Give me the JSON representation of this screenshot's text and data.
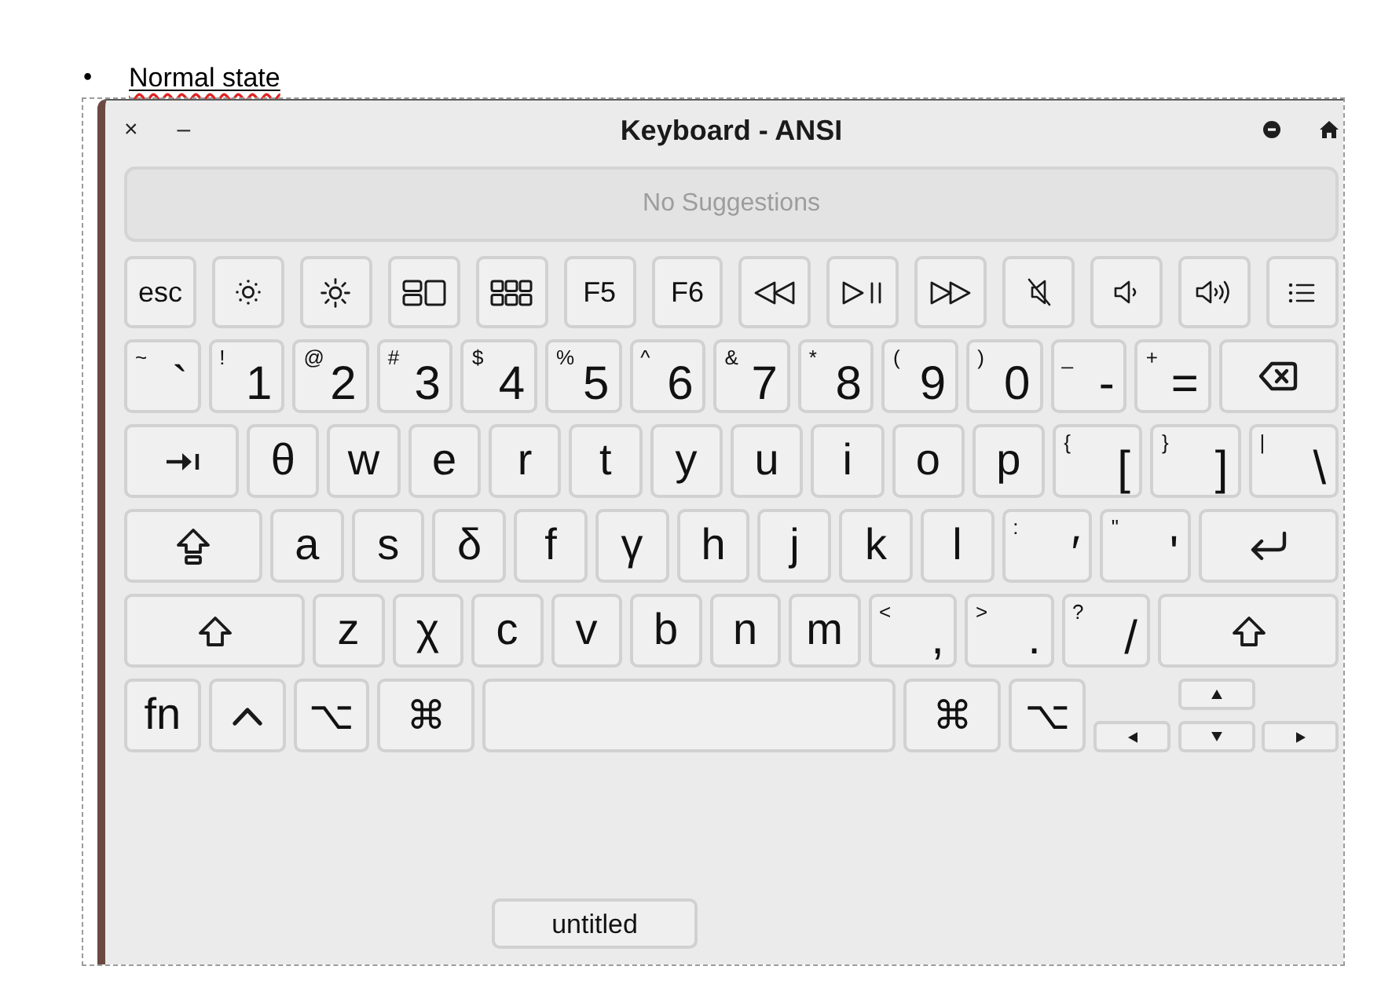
{
  "list_item": {
    "marker": "•",
    "text": "Normal state",
    "underlined": true,
    "spelling_flagged": true
  },
  "window": {
    "close": "×",
    "minimize": "–",
    "title": "Keyboard - ANSI"
  },
  "suggestions": {
    "text": "No Suggestions"
  },
  "keyboard": {
    "rows": [
      {
        "keys": [
          {
            "kind": "text",
            "label": "esc"
          },
          {
            "kind": "dimmer"
          },
          {
            "kind": "brighter"
          },
          {
            "kind": "spaces"
          },
          {
            "kind": "launchpad"
          },
          {
            "kind": "text",
            "label": "F5"
          },
          {
            "kind": "text",
            "label": "F6"
          },
          {
            "kind": "rewind"
          },
          {
            "kind": "play"
          },
          {
            "kind": "forward"
          },
          {
            "kind": "mute"
          },
          {
            "kind": "quieter"
          },
          {
            "kind": "louder"
          },
          {
            "kind": "menu"
          }
        ]
      },
      {
        "keys": [
          {
            "kind": "dual",
            "shift": "~",
            "label": "`"
          },
          {
            "kind": "dual",
            "shift": "!",
            "label": "1"
          },
          {
            "kind": "dual",
            "shift": "@",
            "label": "2"
          },
          {
            "kind": "dual",
            "shift": "#",
            "label": "3"
          },
          {
            "kind": "dual",
            "shift": "$",
            "label": "4"
          },
          {
            "kind": "dual",
            "shift": "%",
            "label": "5"
          },
          {
            "kind": "dual",
            "shift": "^",
            "label": "6"
          },
          {
            "kind": "dual",
            "shift": "&",
            "label": "7"
          },
          {
            "kind": "dual",
            "shift": "*",
            "label": "8"
          },
          {
            "kind": "dual",
            "shift": "(",
            "label": "9"
          },
          {
            "kind": "dual",
            "shift": ")",
            "label": "0"
          },
          {
            "kind": "dual",
            "shift": "_",
            "label": "-"
          },
          {
            "kind": "dual",
            "shift": "+",
            "label": "="
          },
          {
            "kind": "delete"
          }
        ]
      },
      {
        "keys": [
          {
            "kind": "tab"
          },
          {
            "kind": "char",
            "label": "θ"
          },
          {
            "kind": "char",
            "label": "w"
          },
          {
            "kind": "char",
            "label": "e"
          },
          {
            "kind": "char",
            "label": "r"
          },
          {
            "kind": "char",
            "label": "t"
          },
          {
            "kind": "char",
            "label": "y"
          },
          {
            "kind": "char",
            "label": "u"
          },
          {
            "kind": "char",
            "label": "i"
          },
          {
            "kind": "char",
            "label": "o"
          },
          {
            "kind": "char",
            "label": "p"
          },
          {
            "kind": "dual",
            "shift": "{",
            "label": "["
          },
          {
            "kind": "dual",
            "shift": "}",
            "label": "]"
          },
          {
            "kind": "dual",
            "shift": "|",
            "label": "\\"
          }
        ]
      },
      {
        "keys": [
          {
            "kind": "caps"
          },
          {
            "kind": "char",
            "label": "a"
          },
          {
            "kind": "char",
            "label": "s"
          },
          {
            "kind": "char",
            "label": "δ"
          },
          {
            "kind": "char",
            "label": "f"
          },
          {
            "kind": "char",
            "label": "γ"
          },
          {
            "kind": "char",
            "label": "h"
          },
          {
            "kind": "char",
            "label": "j"
          },
          {
            "kind": "char",
            "label": "k"
          },
          {
            "kind": "char",
            "label": "l"
          },
          {
            "kind": "dual",
            "shift": ":",
            "label": "′"
          },
          {
            "kind": "dual",
            "shift": "\"",
            "label": "'"
          },
          {
            "kind": "return"
          }
        ]
      },
      {
        "keys": [
          {
            "kind": "shift"
          },
          {
            "kind": "char",
            "label": "z"
          },
          {
            "kind": "char",
            "label": "χ"
          },
          {
            "kind": "char",
            "label": "c"
          },
          {
            "kind": "char",
            "label": "v"
          },
          {
            "kind": "char",
            "label": "b"
          },
          {
            "kind": "char",
            "label": "n"
          },
          {
            "kind": "char",
            "label": "m"
          },
          {
            "kind": "dual",
            "shift": "<",
            "label": ","
          },
          {
            "kind": "dual",
            "shift": ">",
            "label": "."
          },
          {
            "kind": "dual",
            "shift": "?",
            "label": "/"
          },
          {
            "kind": "shift"
          }
        ]
      },
      {
        "keys": [
          {
            "kind": "text",
            "label": "fn"
          },
          {
            "kind": "control"
          },
          {
            "kind": "option",
            "label": "⌥"
          },
          {
            "kind": "command",
            "label": "⌘"
          },
          {
            "kind": "space"
          },
          {
            "kind": "command",
            "label": "⌘"
          },
          {
            "kind": "option",
            "label": "⌥"
          },
          {
            "kind": "arrows"
          }
        ]
      }
    ]
  },
  "footer": {
    "button": "untitled"
  }
}
